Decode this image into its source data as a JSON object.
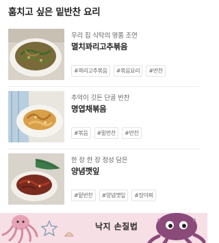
{
  "section": {
    "title": "훔치고 싶은 밑반찬 요리"
  },
  "recipes": [
    {
      "subtitle": "우리 집 식탁의 명품 조연",
      "name": "멸치꽈리고추볶음",
      "tags": [
        "#꽈리고추볶음",
        "#볶음요리",
        "#반찬"
      ]
    },
    {
      "subtitle": "추억이 깃든 단골 반찬",
      "name": "명엽채볶음",
      "tags": [
        "#볶음",
        "#밑반찬",
        "#반찬"
      ]
    },
    {
      "subtitle": "한 장 한 장 정성 담은",
      "name": "양념깻잎",
      "tags": [
        "#밑반찬",
        "#양념깻잎",
        "#장아찌"
      ]
    }
  ],
  "banner": {
    "text": "낙지 손질법"
  },
  "colors": {
    "banner_bg": "#f6dfe5",
    "octopus_purple": "#8a4a7a",
    "octopus_pink": "#e7a3b6"
  },
  "icons": [
    "octopus-icon",
    "starfish-icon",
    "shell-icon"
  ]
}
